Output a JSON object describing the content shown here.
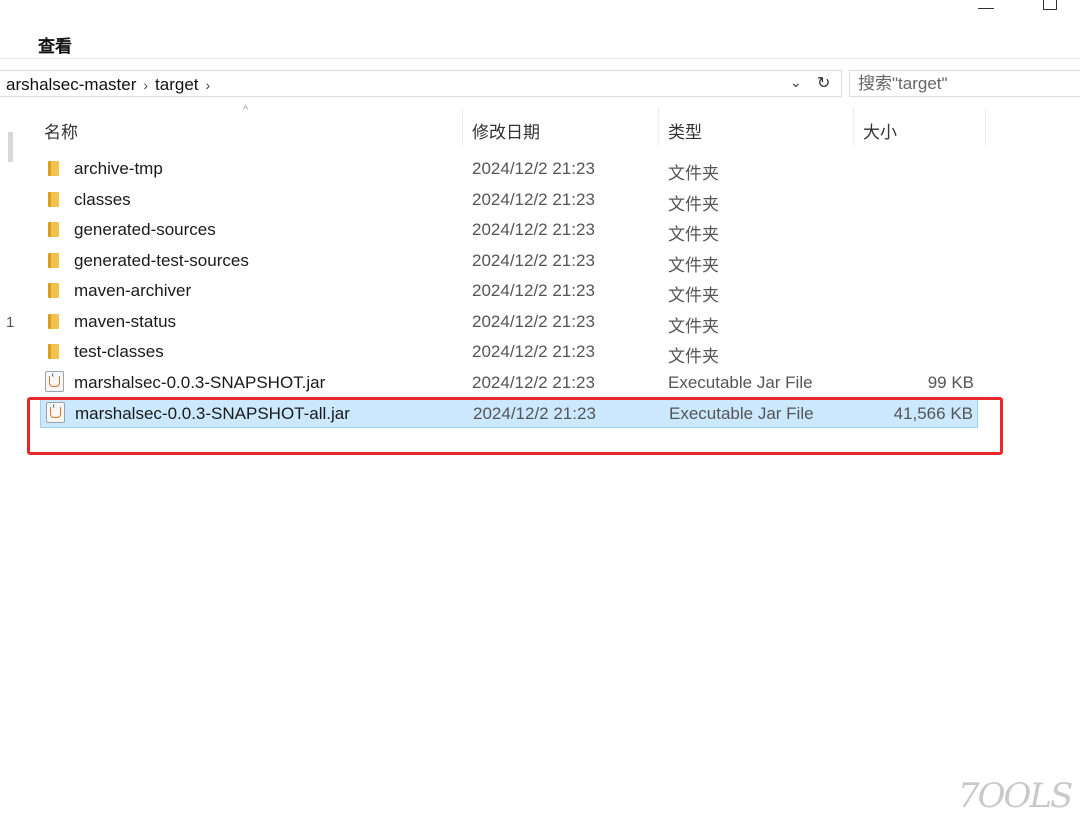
{
  "ribbon": {
    "view_tab": "查看"
  },
  "address": {
    "crumbs": [
      "arshalsec-master",
      "target"
    ],
    "separator": "›",
    "dropdown_icon": "chevron-down-icon",
    "refresh_icon": "refresh-icon"
  },
  "search": {
    "placeholder": "搜索\"target\""
  },
  "columns": {
    "name": "名称",
    "date": "修改日期",
    "type": "类型",
    "size": "大小"
  },
  "files": [
    {
      "name": "archive-tmp",
      "date": "2024/12/2 21:23",
      "type": "文件夹",
      "size": "",
      "icon": "folder-icon"
    },
    {
      "name": "classes",
      "date": "2024/12/2 21:23",
      "type": "文件夹",
      "size": "",
      "icon": "folder-icon"
    },
    {
      "name": "generated-sources",
      "date": "2024/12/2 21:23",
      "type": "文件夹",
      "size": "",
      "icon": "folder-icon"
    },
    {
      "name": "generated-test-sources",
      "date": "2024/12/2 21:23",
      "type": "文件夹",
      "size": "",
      "icon": "folder-icon"
    },
    {
      "name": "maven-archiver",
      "date": "2024/12/2 21:23",
      "type": "文件夹",
      "size": "",
      "icon": "folder-icon"
    },
    {
      "name": "maven-status",
      "date": "2024/12/2 21:23",
      "type": "文件夹",
      "size": "",
      "icon": "folder-icon"
    },
    {
      "name": "test-classes",
      "date": "2024/12/2 21:23",
      "type": "文件夹",
      "size": "",
      "icon": "folder-icon"
    },
    {
      "name": "marshalsec-0.0.3-SNAPSHOT.jar",
      "date": "2024/12/2 21:23",
      "type": "Executable Jar File",
      "size": "99 KB",
      "icon": "java-jar-icon"
    },
    {
      "name": "marshalsec-0.0.3-SNAPSHOT-all.jar",
      "date": "2024/12/2 21:23",
      "type": "Executable Jar File",
      "size": "41,566 KB",
      "icon": "java-jar-icon",
      "selected": true
    }
  ],
  "nav_pane_marks": [
    "1"
  ],
  "annotation_color": "#e8292b",
  "selection_color": "#cce8ff",
  "watermark": "7OOLS"
}
